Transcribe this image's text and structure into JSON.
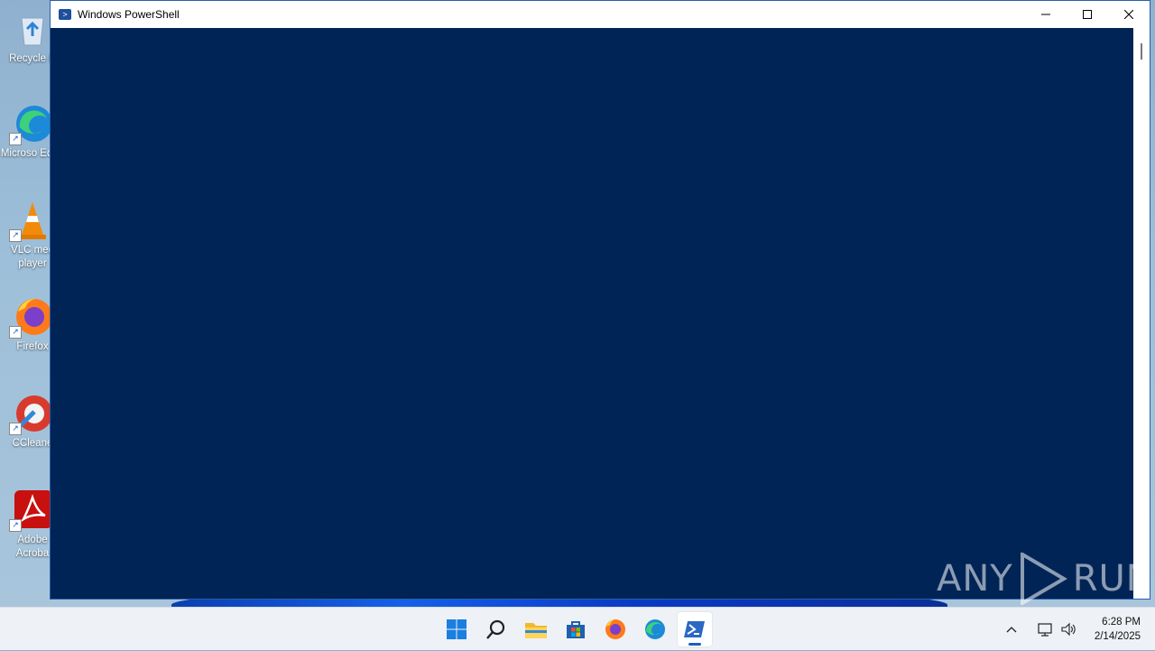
{
  "window": {
    "title": "Windows PowerShell",
    "console_bg": "#012456"
  },
  "desktop_icons": [
    {
      "label": "Recycle B",
      "icon": "recycle-bin-icon"
    },
    {
      "label": "Microso Edge",
      "icon": "edge-icon"
    },
    {
      "label": "VLC med player",
      "icon": "vlc-icon"
    },
    {
      "label": "Firefox",
      "icon": "firefox-icon"
    },
    {
      "label": "CCleane",
      "icon": "ccleaner-icon"
    },
    {
      "label": "Adobe Acroba",
      "icon": "acrobat-icon"
    }
  ],
  "taskbar": {
    "apps": [
      "start-icon",
      "search-icon",
      "file-explorer-icon",
      "store-icon",
      "firefox-icon",
      "edge-icon",
      "powershell-icon"
    ],
    "active_app": "powershell-icon"
  },
  "tray": {
    "time": "6:28 PM",
    "date": "2/14/2025"
  },
  "watermark": {
    "left": "ANY",
    "right": "RUN"
  }
}
